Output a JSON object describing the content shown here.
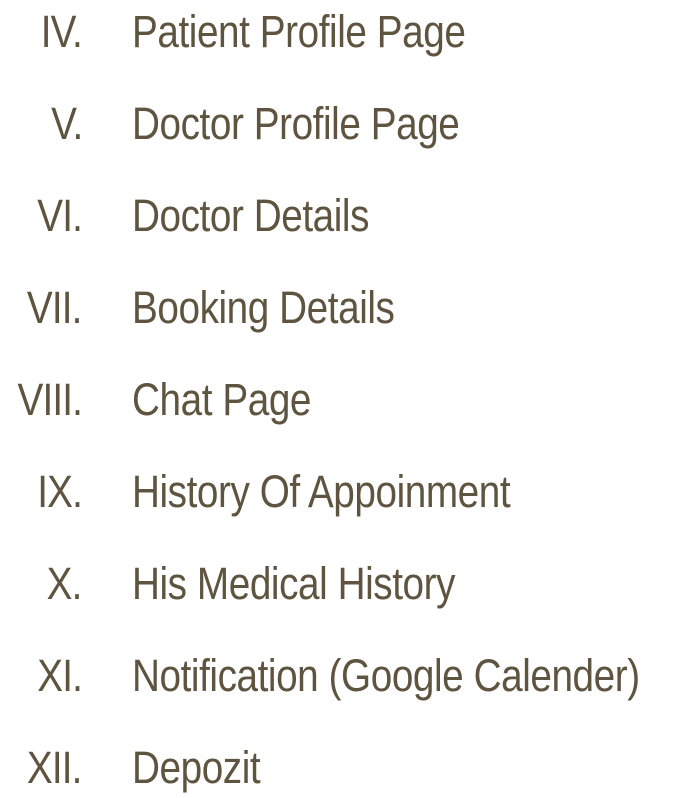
{
  "items": [
    {
      "numeral": "IV.",
      "label": "Patient Profile Page"
    },
    {
      "numeral": "V.",
      "label": "Doctor Profile Page"
    },
    {
      "numeral": "VI.",
      "label": "Doctor Details"
    },
    {
      "numeral": "VII.",
      "label": "Booking Details"
    },
    {
      "numeral": "VIII.",
      "label": "Chat Page"
    },
    {
      "numeral": "IX.",
      "label": "History Of Appoinment"
    },
    {
      "numeral": "X.",
      "label": "His Medical History"
    },
    {
      "numeral": "XI.",
      "label": "Notification (Google Calender)"
    },
    {
      "numeral": "XII.",
      "label": "Depozit"
    }
  ],
  "colors": {
    "text": "#5e5440",
    "background": "#ffffff"
  }
}
